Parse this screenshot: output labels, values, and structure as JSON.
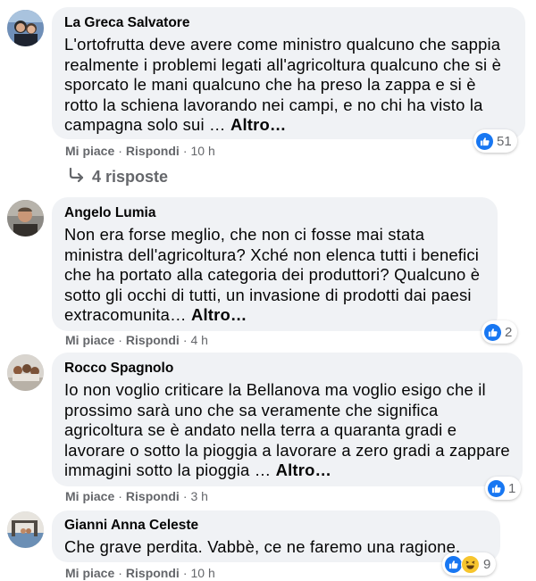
{
  "comments": [
    {
      "author": "La Greca Salvatore",
      "text": "L'ortofrutta deve avere come ministro qualcuno che sappia realmente i problemi legati all'agricoltura qualcuno che si è sporcato le mani qualcuno che ha preso la zappa e si è rotto la schiena lavorando nei campi, e no chi ha visto la campagna solo sui …",
      "more": "Altro…",
      "like": "Mi piace",
      "reply": "Rispondi",
      "time": "10 h",
      "reactions": "51",
      "reaction_icons": [
        "like-icon"
      ]
    },
    {
      "author": "Angelo Lumia",
      "text": "Non era forse meglio, che non ci fosse mai stata ministra dell'agricoltura? Xché non elenca tutti i benefici che ha portato alla categoria dei produttori? Qualcuno è sotto gli occhi di tutti, un invasione di prodotti dai paesi extracomunita…",
      "more": "Altro…",
      "like": "Mi piace",
      "reply": "Rispondi",
      "time": "4 h",
      "reactions": "2",
      "reaction_icons": [
        "like-icon"
      ]
    },
    {
      "author": "Rocco Spagnolo",
      "text": "Io non voglio criticare la Bellanova ma voglio esigo che il prossimo sarà uno che sa veramente che significa agricoltura se è andato nella terra a quaranta gradi e lavorare o sotto la pioggia a lavorare a zero gradi a zappare immagini sotto la pioggia …",
      "more": "Altro…",
      "like": "Mi piace",
      "reply": "Rispondi",
      "time": "3 h",
      "reactions": "1",
      "reaction_icons": [
        "like-icon"
      ]
    },
    {
      "author": "Gianni Anna Celeste",
      "text": "Che grave perdita. Vabbè, ce ne faremo una ragione.",
      "more": "",
      "like": "Mi piace",
      "reply": "Rispondi",
      "time": "10 h",
      "reactions": "9",
      "reaction_icons": [
        "like-icon",
        "haha-icon"
      ]
    }
  ],
  "replies_link": {
    "label": "4 risposte",
    "icon": "reply-arrow-icon"
  },
  "colors": {
    "bubble": "#f0f2f5",
    "like_blue": "#1877f2",
    "meta_gray": "#65676b"
  }
}
